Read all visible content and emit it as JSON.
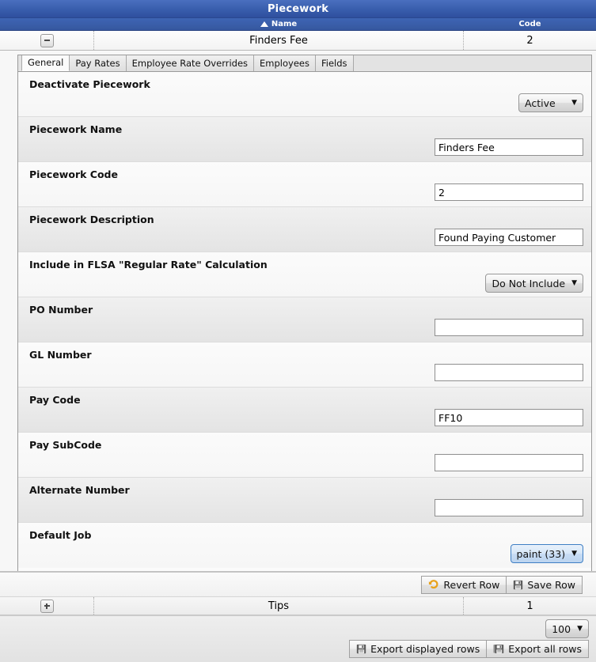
{
  "grid": {
    "title": "Piecework",
    "columns": [
      {
        "label": "Name",
        "sort": "asc"
      },
      {
        "label": "Code"
      }
    ],
    "selected_row": {
      "name": "Finders Fee",
      "code": "2",
      "expander": "collapse-icon"
    },
    "group_row": {
      "name": "Tips",
      "code": "1",
      "expander": "expand-icon"
    }
  },
  "tabs": [
    {
      "label": "General",
      "active": true
    },
    {
      "label": "Pay Rates",
      "active": false
    },
    {
      "label": "Employee Rate Overrides",
      "active": false
    },
    {
      "label": "Employees",
      "active": false
    },
    {
      "label": "Fields",
      "active": false
    }
  ],
  "form": {
    "fields": [
      {
        "label": "Deactivate Piecework",
        "type": "dropdown",
        "value": "Active",
        "caret": "▼"
      },
      {
        "label": "Piecework Name",
        "type": "text",
        "value": "Finders Fee",
        "placeholder": ""
      },
      {
        "label": "Piecework Code",
        "type": "text",
        "value": "2",
        "placeholder": ""
      },
      {
        "label": "Piecework Description",
        "type": "text",
        "value": "Found Paying Customer",
        "placeholder": ""
      },
      {
        "label": "Include in FLSA \"Regular Rate\" Calculation",
        "type": "dropdown",
        "value": "Do Not Include",
        "caret": "▼"
      },
      {
        "label": "PO Number",
        "type": "text",
        "value": "",
        "placeholder": ""
      },
      {
        "label": "GL Number",
        "type": "text",
        "value": "",
        "placeholder": ""
      },
      {
        "label": "Pay Code",
        "type": "text",
        "value": "FF10",
        "placeholder": ""
      },
      {
        "label": "Pay SubCode",
        "type": "text",
        "value": "",
        "placeholder": ""
      },
      {
        "label": "Alternate Number",
        "type": "text",
        "value": "",
        "placeholder": ""
      },
      {
        "label": "Default Job",
        "type": "dropdown-highlight",
        "value": "paint (33)",
        "caret": "▼"
      }
    ]
  },
  "actions": {
    "revert_label": "Revert Row",
    "revert_icon": "undo-icon",
    "save_label": "Save Row",
    "save_icon": "floppy-disk-icon"
  },
  "footer": {
    "page_size": "100",
    "page_size_caret": "▼",
    "export_displayed_label": "Export displayed rows",
    "export_displayed_icon": "floppy-disk-icon",
    "export_all_label": "Export all rows",
    "export_all_icon": "floppy-disk-stack-icon"
  },
  "colors": {
    "header_blue": "#3a5fae",
    "column_header_blue": "#36589f",
    "highlight_border": "#3f7fc4",
    "highlight_fill": "#d7e7f8",
    "undo_icon": "#e8a21c",
    "row_even": "#e8e8e8",
    "row_odd": "#f8f8f8"
  }
}
